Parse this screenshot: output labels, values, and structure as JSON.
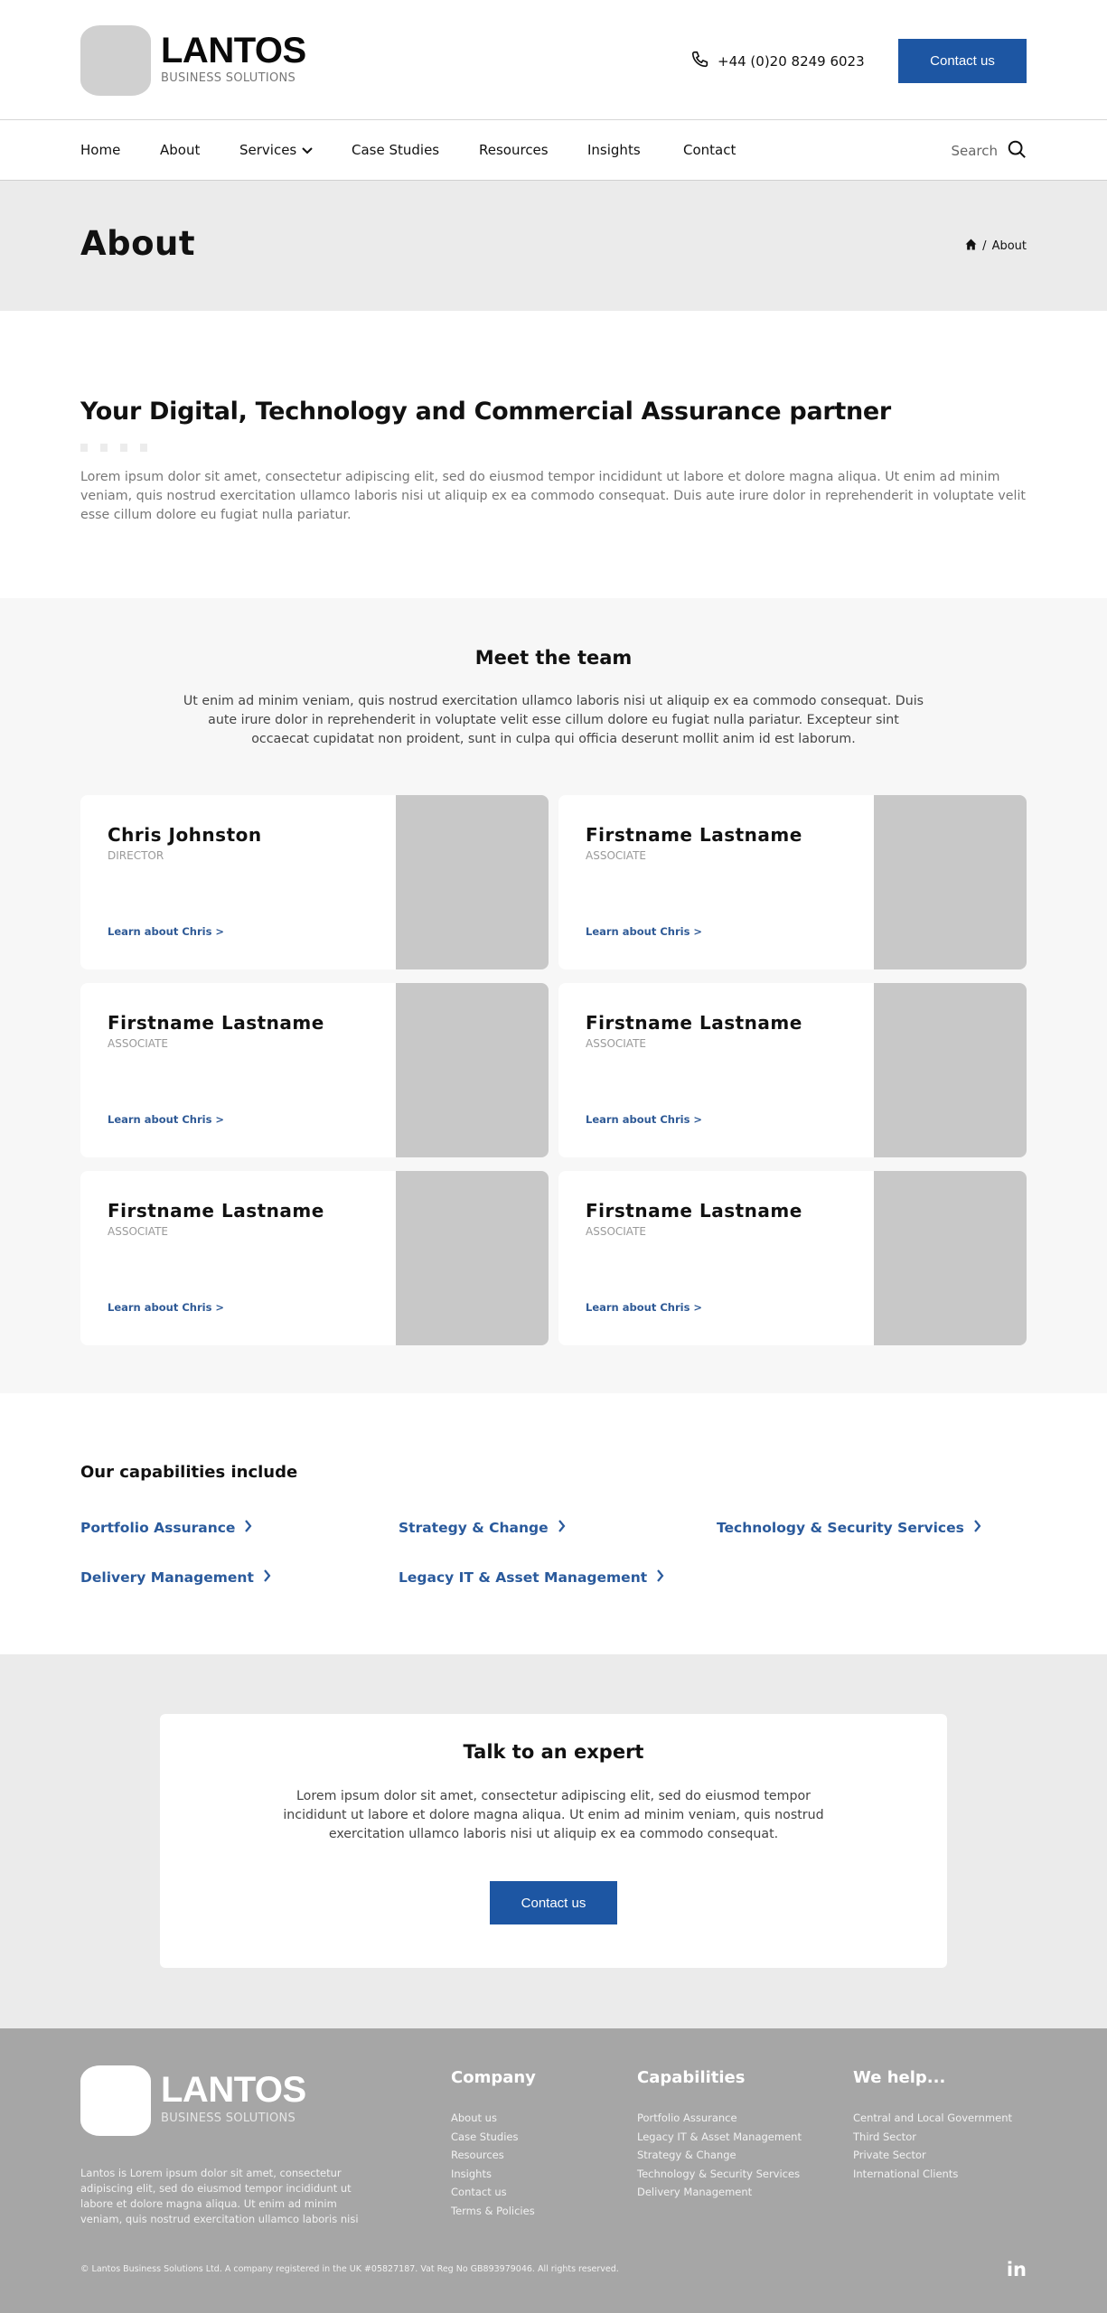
{
  "header": {
    "logo_title": "LANTOS",
    "logo_subtitle": "BUSINESS SOLUTIONS",
    "phone": "+44 (0)20 8249 6023",
    "contact_button": "Contact us"
  },
  "nav": {
    "items": [
      {
        "label": "Home"
      },
      {
        "label": "About"
      },
      {
        "label": "Services",
        "has_dropdown": true
      },
      {
        "label": "Case Studies"
      },
      {
        "label": "Resources"
      },
      {
        "label": "Insights"
      },
      {
        "label": "Contact"
      }
    ],
    "search_label": "Search"
  },
  "page_title": "About",
  "breadcrumb": {
    "separator": "/",
    "current": "About"
  },
  "intro": {
    "heading": "Your Digital, Technology and Commercial Assurance partner",
    "body": "Lorem ipsum dolor sit amet, consectetur adipiscing elit, sed do eiusmod tempor incididunt ut labore et dolore magna aliqua. Ut enim ad minim veniam, quis nostrud exercitation ullamco laboris nisi ut aliquip ex ea commodo consequat. Duis aute irure dolor in reprehenderit in voluptate velit esse cillum dolore eu fugiat nulla pariatur."
  },
  "team": {
    "heading": "Meet the team",
    "body": "Ut enim ad minim veniam, quis nostrud exercitation ullamco laboris nisi ut aliquip ex ea commodo consequat. Duis aute irure dolor in reprehenderit in voluptate velit esse cillum dolore eu fugiat nulla pariatur. Excepteur sint occaecat cupidatat non proident, sunt in culpa qui officia deserunt mollit anim id est laborum.",
    "members": [
      {
        "name": "Chris Johnston",
        "role": "DIRECTOR",
        "link": "Learn about Chris >"
      },
      {
        "name": "Firstname Lastname",
        "role": "ASSOCIATE",
        "link": "Learn about Chris >"
      },
      {
        "name": "Firstname Lastname",
        "role": "ASSOCIATE",
        "link": "Learn about Chris >"
      },
      {
        "name": "Firstname Lastname",
        "role": "ASSOCIATE",
        "link": "Learn about Chris >"
      },
      {
        "name": "Firstname Lastname",
        "role": "ASSOCIATE",
        "link": "Learn about Chris >"
      },
      {
        "name": "Firstname Lastname",
        "role": "ASSOCIATE",
        "link": "Learn about Chris >"
      }
    ]
  },
  "capabilities": {
    "heading": "Our capabilities include",
    "items": [
      {
        "label": "Portfolio Assurance"
      },
      {
        "label": "Strategy & Change"
      },
      {
        "label": "Technology & Security Services"
      },
      {
        "label": "Delivery Management"
      },
      {
        "label": "Legacy IT & Asset Management"
      }
    ]
  },
  "cta": {
    "heading": "Talk to an expert",
    "body": "Lorem ipsum dolor sit amet, consectetur adipiscing elit, sed do eiusmod tempor incididunt ut labore et dolore magna aliqua. Ut enim ad minim veniam, quis nostrud exercitation ullamco laboris nisi ut aliquip ex ea commodo consequat.",
    "button": "Contact us"
  },
  "footer": {
    "logo_title": "LANTOS",
    "logo_subtitle": "BUSINESS SOLUTIONS",
    "about": "Lantos is Lorem ipsum dolor sit amet, consectetur adipiscing elit, sed do eiusmod tempor incididunt ut labore et dolore magna aliqua. Ut enim ad minim veniam, quis nostrud exercitation ullamco laboris nisi",
    "columns": [
      {
        "heading": "Company",
        "links": [
          "About us",
          "Case Studies",
          "Resources",
          "Insights",
          "Contact us",
          "Terms & Policies"
        ]
      },
      {
        "heading": "Capabilities",
        "links": [
          "Portfolio Assurance",
          "Legacy IT & Asset Management",
          "Strategy & Change",
          "Technology & Security Services",
          "Delivery Management"
        ]
      },
      {
        "heading": "We help...",
        "links": [
          "Central and Local Government",
          "Third Sector",
          "Private Sector",
          "International Clients"
        ]
      }
    ],
    "legal": "© Lantos Business Solutions Ltd. A company registered in the UK #05827187. Vat Reg No GB893979046. All rights reserved.",
    "social_label": "in"
  },
  "colors": {
    "accent": "#1d56a3",
    "link": "#2a5a9c",
    "footer_bg": "#a6a6a6",
    "band_bg": "#ebebeb"
  }
}
